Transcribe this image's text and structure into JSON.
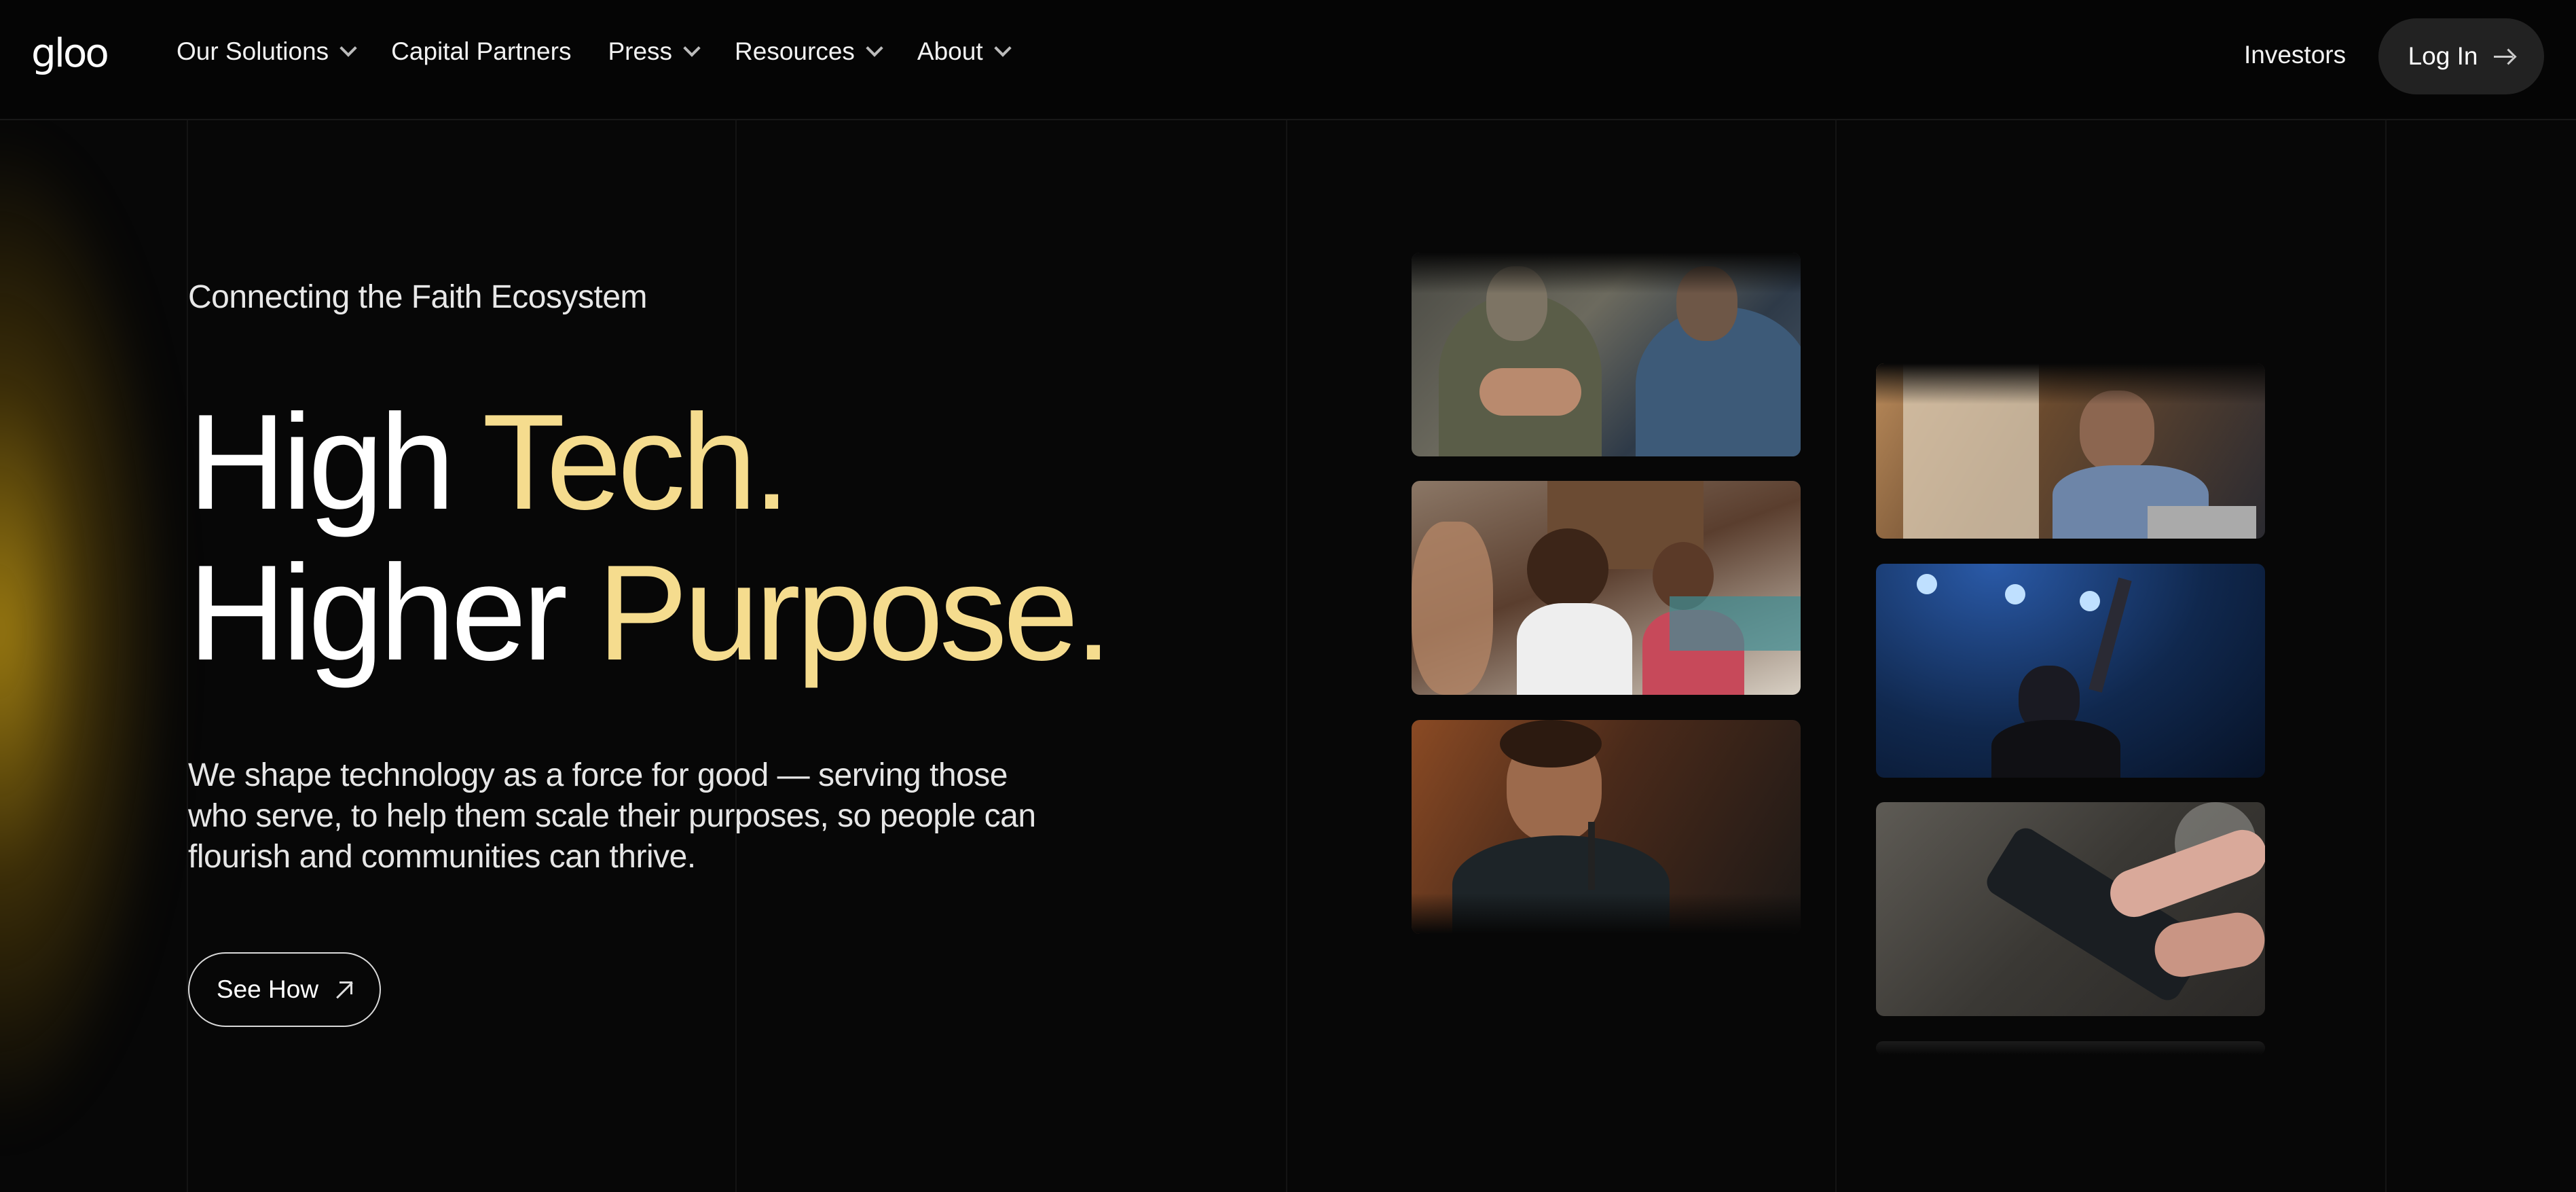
{
  "brand": {
    "logo_text": "gloo"
  },
  "nav": {
    "items": [
      {
        "label": "Our Solutions",
        "has_dropdown": true
      },
      {
        "label": "Capital Partners",
        "has_dropdown": false
      },
      {
        "label": "Press",
        "has_dropdown": true
      },
      {
        "label": "Resources",
        "has_dropdown": true
      },
      {
        "label": "About",
        "has_dropdown": true
      }
    ],
    "investors_label": "Investors",
    "login_label": "Log In"
  },
  "hero": {
    "eyebrow": "Connecting the Faith Ecosystem",
    "headline_line1_white": "High ",
    "headline_line1_gold": "Tech.",
    "headline_line2_white": "Higher ",
    "headline_line2_gold": "Purpose.",
    "description": "We shape technology as a force for good — serving those who serve, to help them scale their purposes, so people can flourish and communities can thrive.",
    "cta_label": "See How"
  },
  "gallery": {
    "images": [
      {
        "subject": "hand-on-shoulder-photo"
      },
      {
        "subject": "two-women-talking-photo"
      },
      {
        "subject": "man-singing-microphone-photo"
      },
      {
        "subject": "people-working-laptop-photo"
      },
      {
        "subject": "woman-worship-stage-photo"
      },
      {
        "subject": "hand-holding-phone-photo"
      }
    ]
  },
  "colors": {
    "background": "#070707",
    "accent_gold": "#f5dc8e",
    "glow": "#be9614"
  }
}
